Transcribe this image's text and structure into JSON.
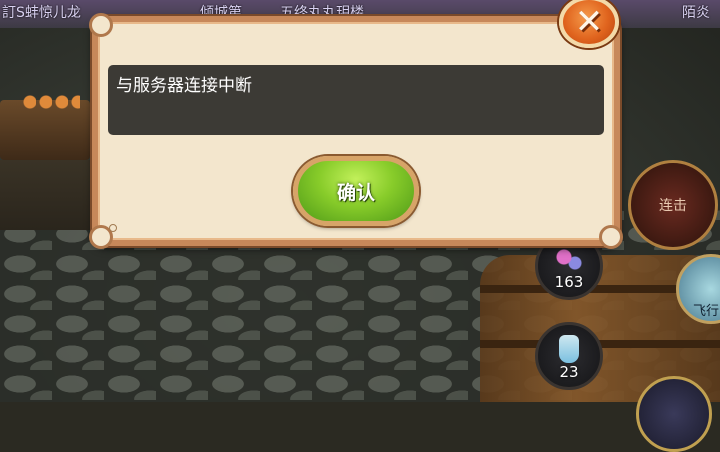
{
  "scene": {
    "top_labels": [
      "訂S蚌惊儿龙",
      "倾城第",
      "五终丸丸玥楼",
      "陌炎"
    ]
  },
  "dialog": {
    "message": "与服务器连接中断",
    "confirm_label": "确认",
    "close_icon": "close-icon"
  },
  "hud": {
    "combo_label": "连击",
    "flower_count": "163",
    "bottle_count": "23",
    "fly_label": "飞行"
  },
  "colors": {
    "dialog_bg": "#f3e6cd",
    "dialog_border": "#c7885a",
    "message_bg": "#3c3a35",
    "confirm_green": "#88cc2a",
    "close_orange": "#e0641e"
  }
}
